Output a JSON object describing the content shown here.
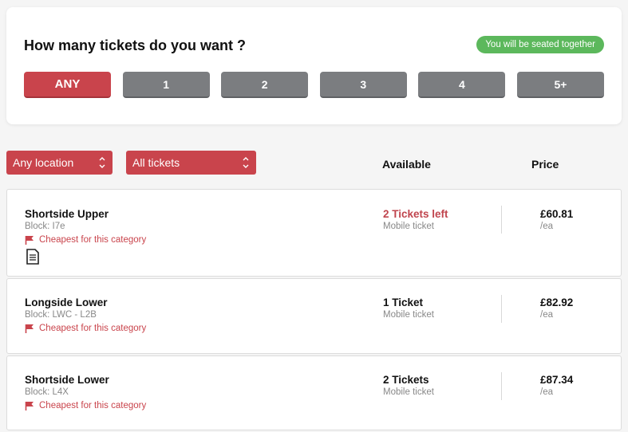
{
  "quantity": {
    "title": "How many tickets do you want ?",
    "seated_badge": "You will be seated together",
    "options": [
      "ANY",
      "1",
      "2",
      "3",
      "4",
      "5+"
    ],
    "selected": "ANY"
  },
  "filters": {
    "location": "Any location",
    "tickets": "All tickets"
  },
  "columns": {
    "available": "Available",
    "price": "Price"
  },
  "listings": [
    {
      "name": "Shortside Upper",
      "block": "Block: I7e",
      "note": "Cheapest for this category",
      "availability": "2 Tickets left",
      "ticket_type": "Mobile ticket",
      "price": "£60.81",
      "per": "/ea"
    },
    {
      "name": "Longside Lower",
      "block": "Block: LWC - L2B",
      "note": "Cheapest for this category",
      "availability": "1 Ticket",
      "ticket_type": "Mobile ticket",
      "price": "£82.92",
      "per": "/ea"
    },
    {
      "name": "Shortside Lower",
      "block": "Block: L4X",
      "note": "Cheapest for this category",
      "availability": "2 Tickets",
      "ticket_type": "Mobile ticket",
      "price": "£87.34",
      "per": "/ea"
    }
  ],
  "colors": {
    "accent": "#c9444c",
    "button_inactive": "#7b7d80",
    "badge": "#5cb85c"
  },
  "icons": {
    "flag": "flag-icon",
    "document": "document-icon",
    "select_arrows": "chevron-up-down-icon"
  }
}
